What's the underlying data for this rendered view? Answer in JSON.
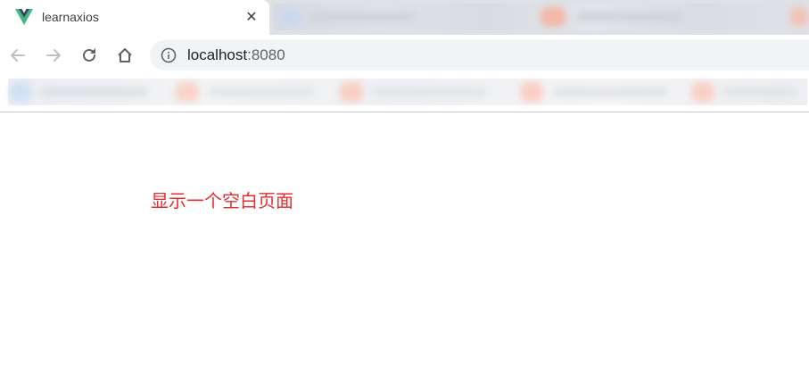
{
  "browser": {
    "tab": {
      "title": "learnaxios",
      "favicon": "vue-logo-icon",
      "close_icon": "close-icon"
    },
    "toolbar": {
      "back_icon": "back-arrow-icon",
      "forward_icon": "forward-arrow-icon",
      "reload_icon": "reload-icon",
      "home_icon": "home-icon",
      "info_icon": "info-icon"
    },
    "address": {
      "host": "localhost",
      "port": ":8080"
    }
  },
  "page": {
    "message": "显示一个空白页面",
    "message_color": "#e52d2d"
  },
  "colors": {
    "vue_green": "#41b883",
    "vue_dark": "#35495e"
  }
}
